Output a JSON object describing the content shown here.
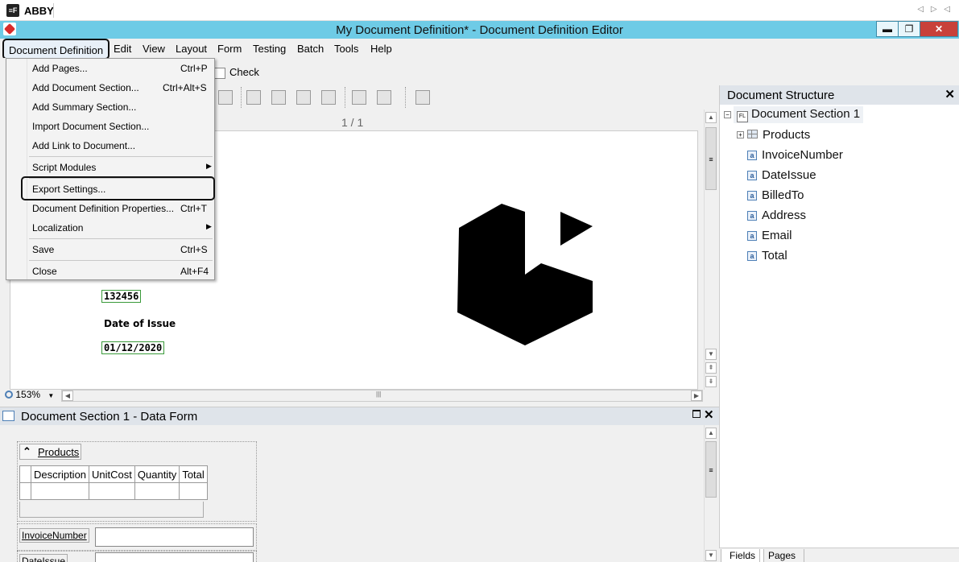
{
  "appstrip": {
    "logo": "≡F",
    "app_name": "ABBY",
    "nav": "◁ ▷ ◁"
  },
  "window": {
    "title": "My Document Definition* - Document Definition Editor",
    "min": "▬",
    "restore": "❐",
    "close": "✕"
  },
  "menubar": {
    "items": [
      "Document Definition",
      "Edit",
      "View",
      "Layout",
      "Form",
      "Testing",
      "Batch",
      "Tools",
      "Help"
    ]
  },
  "toolbar": {
    "check_label": "Check"
  },
  "dropdown": {
    "items": [
      {
        "label": "Add Pages...",
        "shortcut": "Ctrl+P"
      },
      {
        "label": "Add Document Section...",
        "shortcut": "Ctrl+Alt+S"
      },
      {
        "label": "Add Summary Section...",
        "shortcut": ""
      },
      {
        "label": "Import Document Section...",
        "shortcut": ""
      },
      {
        "label": "Add Link to Document...",
        "shortcut": ""
      },
      {
        "label": "Script Modules",
        "shortcut": "",
        "submenu": "▶"
      },
      {
        "label": "Export Settings...",
        "shortcut": ""
      },
      {
        "label": "Document Definition Properties...",
        "shortcut": "Ctrl+T"
      },
      {
        "label": "Localization",
        "shortcut": "",
        "submenu": "▶"
      },
      {
        "label": "Save",
        "shortcut": "Ctrl+S"
      },
      {
        "label": "Close",
        "shortcut": "Alt+F4"
      }
    ]
  },
  "document": {
    "page_indicator": "1 / 1",
    "invoice_number": "132456",
    "date_label": "Date of Issue",
    "date_value": "01/12/2020",
    "zoom": "153%",
    "zoom_arrow": "▼"
  },
  "scroll": {
    "up": "▲",
    "down": "▼",
    "left": "◀",
    "right": "▶",
    "thumb": "≡",
    "hthumb": "|||",
    "pg_up": "⇞",
    "pg_down": "⇟"
  },
  "structure": {
    "title": "Document Structure",
    "close": "✕",
    "section": "Document Section 1",
    "section_icon": "FL",
    "items": [
      "Products",
      "InvoiceNumber",
      "DateIssue",
      "BilledTo",
      "Address",
      "Email",
      "Total"
    ],
    "field_icon": "a",
    "collapse": "−",
    "expand": "+",
    "tabs": [
      "Fields",
      "Pages"
    ]
  },
  "dataform": {
    "title": "Document Section 1 - Data Form",
    "close": "✕",
    "products_link": "Products",
    "products_icon": "⌃",
    "table_headers": [
      "Description",
      "UnitCost",
      "Quantity",
      "Total"
    ],
    "invoice_label": "InvoiceNumber",
    "dateissue_label": "DateIssue"
  }
}
